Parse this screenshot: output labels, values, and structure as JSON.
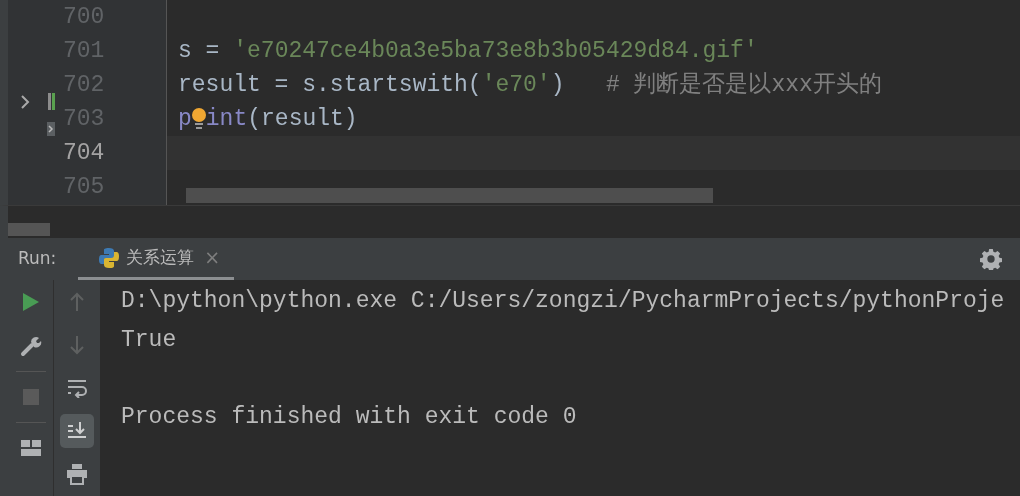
{
  "editor": {
    "lines": [
      {
        "number": "700",
        "current": false
      },
      {
        "number": "701",
        "current": false,
        "tokens": [
          {
            "text": "s = ",
            "kind": "plain"
          },
          {
            "text": "'e70247ce4b0a3e5ba73e8b3b05429d84.gif'",
            "kind": "string"
          }
        ]
      },
      {
        "number": "702",
        "current": false,
        "tokens": [
          {
            "text": "result = s.startswith(",
            "kind": "plain"
          },
          {
            "text": "'e70'",
            "kind": "string"
          },
          {
            "text": ")",
            "kind": "plain"
          },
          {
            "text": "   # 判断是否是以xxx开头的",
            "kind": "comment"
          }
        ]
      },
      {
        "number": "703",
        "current": false,
        "tokens": [
          {
            "text": "p",
            "kind": "builtin"
          },
          {
            "kind": "lightbulb"
          },
          {
            "text": "int",
            "kind": "builtin"
          },
          {
            "text": "(result)",
            "kind": "plain"
          }
        ]
      },
      {
        "number": "704",
        "current": true
      },
      {
        "number": "705",
        "current": false
      }
    ]
  },
  "run_panel": {
    "label": "Run:",
    "tabs": [
      {
        "title": "关系运算",
        "selected": true,
        "close": "×"
      }
    ],
    "console": [
      {
        "text": "D:\\python\\python.exe C:/Users/zongzi/PycharmProjects/pythonProje"
      },
      {
        "text": "True"
      },
      {
        "text": "Process finished with exit code 0",
        "blank_before": true
      }
    ]
  }
}
